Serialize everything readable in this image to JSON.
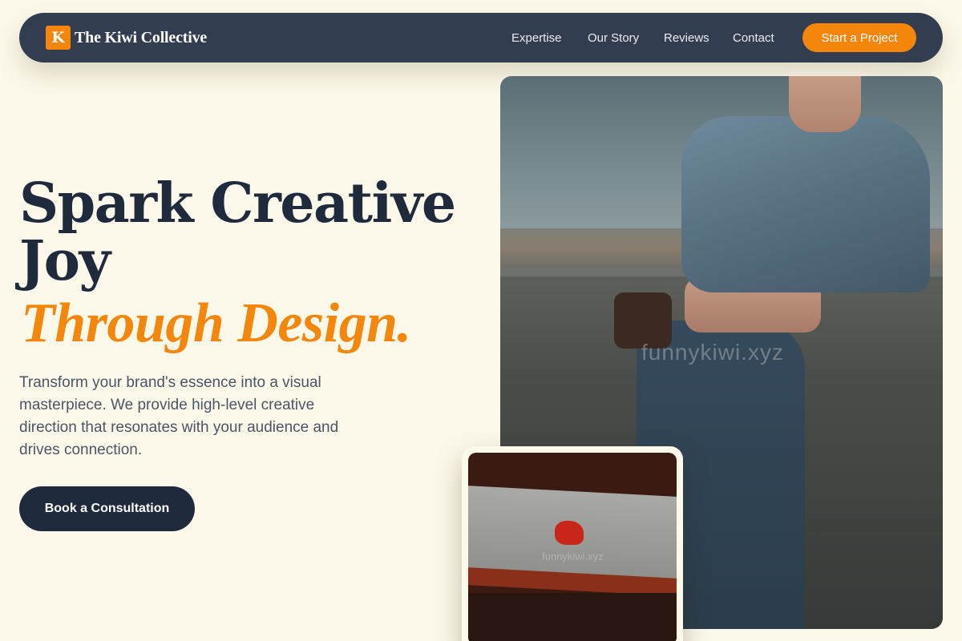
{
  "nav": {
    "logo_letter": "K",
    "brand": "The Kiwi Collective",
    "links": [
      "Expertise",
      "Our Story",
      "Reviews",
      "Contact"
    ],
    "cta": "Start a Project"
  },
  "hero": {
    "title_line1": "Spark Creative",
    "title_line2": "Joy",
    "title_accent": "Through Design.",
    "lede": "Transform your brand's essence into a visual masterpiece. We provide high-level creative direction that resonates with your audience and drives connection.",
    "button": "Book a Consultation"
  },
  "images": {
    "watermark": "funnykiwi.xyz"
  },
  "colors": {
    "accent": "#f5860c",
    "navy": "#1f2a3d",
    "nav_bg": "#323d4f",
    "page_bg": "#fdf9ea"
  }
}
